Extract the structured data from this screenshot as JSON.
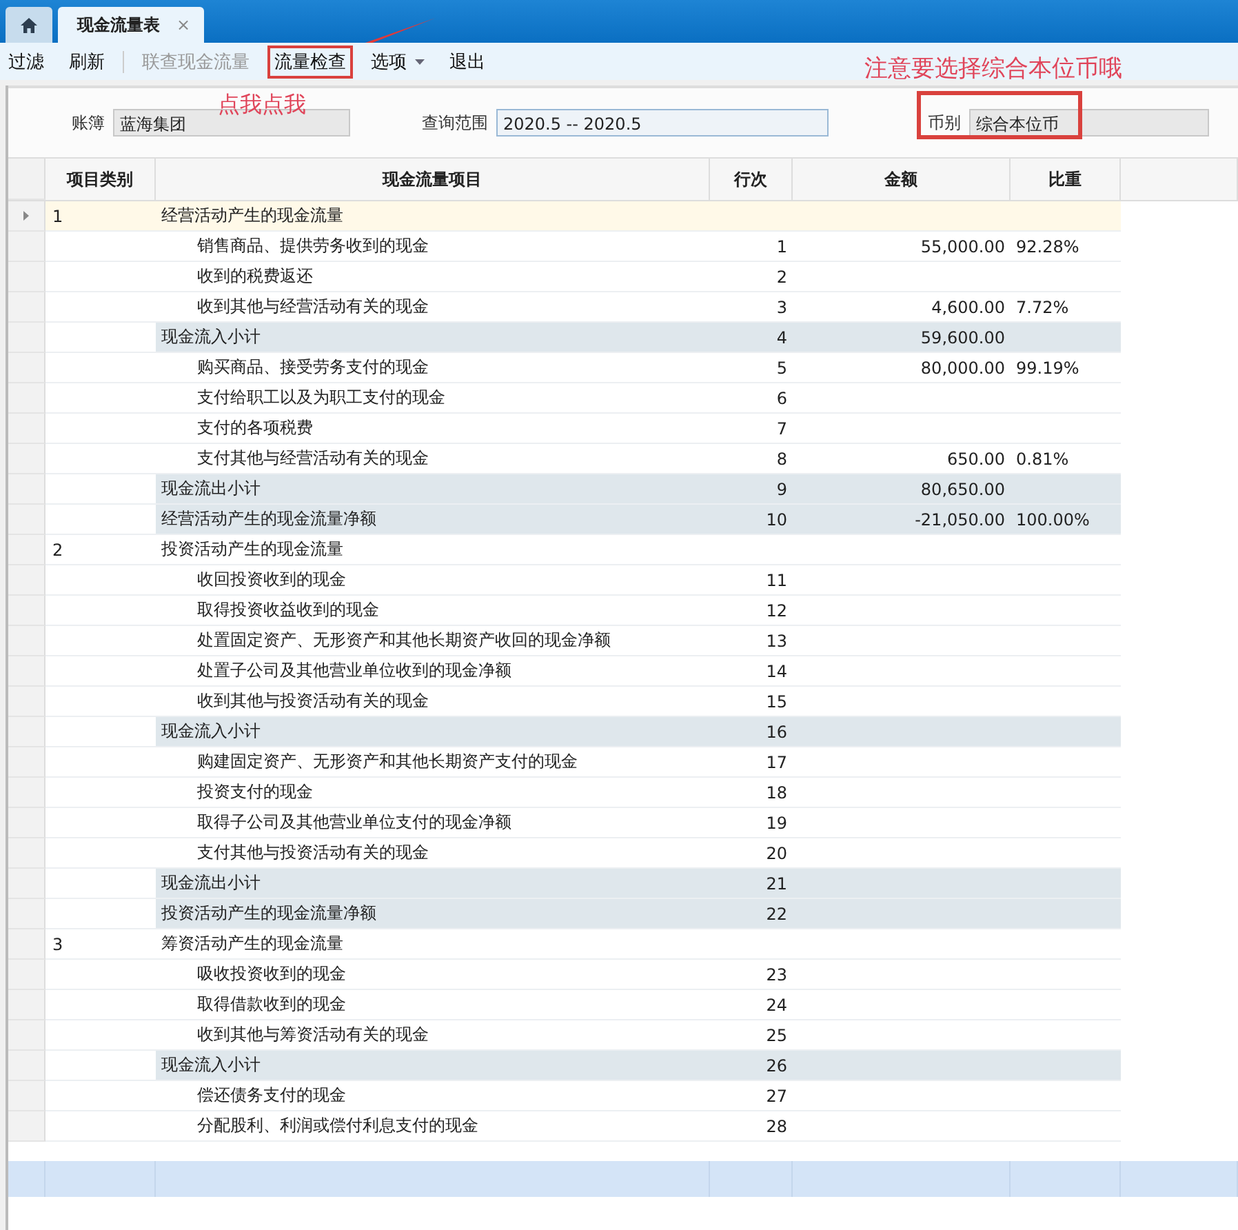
{
  "tabs": [
    {
      "kind": "home",
      "selected": false
    },
    {
      "kind": "doc",
      "label": "现金流量表",
      "close": "×",
      "selected": true
    }
  ],
  "toolbar": [
    {
      "label": "过滤",
      "disabled": false,
      "highlighted": false
    },
    {
      "label": "刷新",
      "disabled": false,
      "highlighted": false,
      "separator_after": true
    },
    {
      "label": "联查现金流量",
      "disabled": true,
      "highlighted": false
    },
    {
      "label": "流量检查",
      "disabled": false,
      "highlighted": true
    },
    {
      "label": "选项",
      "disabled": false,
      "highlighted": false,
      "dropdown": true
    },
    {
      "label": "退出",
      "disabled": false,
      "highlighted": false
    }
  ],
  "form": {
    "ledger": {
      "label": "账簿",
      "value": "蓝海集团"
    },
    "range": {
      "label": "查询范围",
      "value": "2020.5 -- 2020.5"
    },
    "currency": {
      "label": "币别",
      "value": "综合本位币",
      "highlighted": true
    }
  },
  "annotations": {
    "click_note": "点我点我",
    "currency_note": "注意要选择综合本位币哦"
  },
  "table": {
    "columns": [
      "项目类别",
      "现金流量项目",
      "行次",
      "金额",
      "比重"
    ],
    "rows": [
      {
        "kind": "section",
        "category": "1",
        "item": "经营活动产生的现金流量",
        "selected": true
      },
      {
        "kind": "item",
        "item": "销售商品、提供劳务收到的现金",
        "line": "1",
        "amount": "55,000.00",
        "ratio": "92.28%",
        "selected": false
      },
      {
        "kind": "item",
        "item": "收到的税费返还",
        "line": "2",
        "selected": false
      },
      {
        "kind": "item",
        "item": "收到其他与经营活动有关的现金",
        "line": "3",
        "amount": "4,600.00",
        "ratio": "7.72%",
        "selected": false
      },
      {
        "kind": "subtotal",
        "item": "现金流入小计",
        "line": "4",
        "amount": "59,600.00",
        "selected": false
      },
      {
        "kind": "item",
        "item": "购买商品、接受劳务支付的现金",
        "line": "5",
        "amount": "80,000.00",
        "ratio": "99.19%",
        "selected": false
      },
      {
        "kind": "item",
        "item": "支付给职工以及为职工支付的现金",
        "line": "6",
        "selected": false
      },
      {
        "kind": "item",
        "item": "支付的各项税费",
        "line": "7",
        "selected": false
      },
      {
        "kind": "item",
        "item": "支付其他与经营活动有关的现金",
        "line": "8",
        "amount": "650.00",
        "ratio": "0.81%",
        "selected": false
      },
      {
        "kind": "subtotal",
        "item": "现金流出小计",
        "line": "9",
        "amount": "80,650.00",
        "selected": false
      },
      {
        "kind": "subtotal",
        "item": "经营活动产生的现金流量净额",
        "line": "10",
        "amount": "-21,050.00",
        "ratio": "100.00%",
        "selected": false
      },
      {
        "kind": "section",
        "category": "2",
        "item": "投资活动产生的现金流量",
        "selected": false
      },
      {
        "kind": "item",
        "item": "收回投资收到的现金",
        "line": "11",
        "selected": false
      },
      {
        "kind": "item",
        "item": "取得投资收益收到的现金",
        "line": "12",
        "selected": false
      },
      {
        "kind": "item",
        "item": "处置固定资产、无形资产和其他长期资产收回的现金净额",
        "line": "13",
        "selected": false
      },
      {
        "kind": "item",
        "item": "处置子公司及其他营业单位收到的现金净额",
        "line": "14",
        "selected": false
      },
      {
        "kind": "item",
        "item": "收到其他与投资活动有关的现金",
        "line": "15",
        "selected": false
      },
      {
        "kind": "subtotal",
        "item": "现金流入小计",
        "line": "16",
        "selected": false
      },
      {
        "kind": "item",
        "item": "购建固定资产、无形资产和其他长期资产支付的现金",
        "line": "17",
        "selected": false
      },
      {
        "kind": "item",
        "item": "投资支付的现金",
        "line": "18",
        "selected": false
      },
      {
        "kind": "item",
        "item": "取得子公司及其他营业单位支付的现金净额",
        "line": "19",
        "selected": false
      },
      {
        "kind": "item",
        "item": "支付其他与投资活动有关的现金",
        "line": "20",
        "selected": false
      },
      {
        "kind": "subtotal",
        "item": "现金流出小计",
        "line": "21",
        "selected": false
      },
      {
        "kind": "subtotal",
        "item": "投资活动产生的现金流量净额",
        "line": "22",
        "selected": false
      },
      {
        "kind": "section",
        "category": "3",
        "item": "筹资活动产生的现金流量",
        "selected": false
      },
      {
        "kind": "item",
        "item": "吸收投资收到的现金",
        "line": "23",
        "selected": false
      },
      {
        "kind": "item",
        "item": "取得借款收到的现金",
        "line": "24",
        "selected": false
      },
      {
        "kind": "item",
        "item": "收到其他与筹资活动有关的现金",
        "line": "25",
        "selected": false
      },
      {
        "kind": "subtotal",
        "item": "现金流入小计",
        "line": "26",
        "selected": false
      },
      {
        "kind": "item",
        "item": "偿还债务支付的现金",
        "line": "27",
        "selected": false
      },
      {
        "kind": "item",
        "item": "分配股利、利润或偿付利息支付的现金",
        "line": "28",
        "selected": false
      }
    ]
  }
}
